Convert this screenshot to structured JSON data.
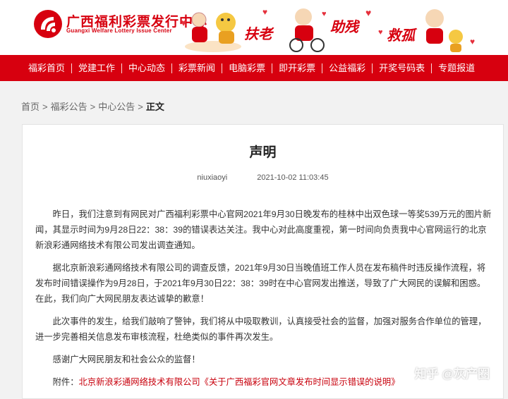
{
  "header": {
    "brand_cn": "广西福利彩票发行中心",
    "brand_en": "Guangxi Welfare Lottery Issue Center",
    "slogans": [
      "扶老",
      "助残",
      "救孤"
    ]
  },
  "nav": {
    "items": [
      "福彩首页",
      "党建工作",
      "中心动态",
      "彩票新闻",
      "电脑彩票",
      "即开彩票",
      "公益福彩",
      "开奖号码表",
      "专题报道"
    ]
  },
  "breadcrumb": {
    "home": "首页",
    "level1": "福彩公告",
    "level2": "中心公告",
    "current": "正文",
    "separator": ">"
  },
  "article": {
    "title": "声明",
    "author": "niuxiaoyi",
    "datetime": "2021-10-02 11:03:45",
    "paragraphs": [
      "昨日，我们注意到有网民对广西福利彩票中心官网2021年9月30日晚发布的桂林中出双色球一等奖539万元的图片新闻，其显示时间为9月28日22：38：39的错误表达关注。我中心对此高度重视，第一时间向负责我中心官网运行的北京新浪彩通网络技术有限公司发出调查通知。",
      "据北京新浪彩通网络技术有限公司的调查反馈，2021年9月30日当晚值班工作人员在发布稿件时违反操作流程，将发布时间错误操作为9月28日，于2021年9月30日22：38：39时在中心官网发出推送，导致了广大网民的误解和困惑。在此，我们向广大网民朋友表达诚挚的歉意！",
      "此次事件的发生，给我们敲响了警钟，我们将从中吸取教训，认真接受社会的监督，加强对服务合作单位的管理，进一步完善相关信息发布审核流程，杜绝类似的事件再次发生。",
      "感谢广大网民朋友和社会公众的监督！"
    ],
    "attachment_label": "附件：",
    "attachment_link": "北京新浪彩通网络技术有限公司《关于广西福彩官网文章发布时间显示错误的说明》"
  },
  "watermark": "知乎 @灰产圈",
  "colors": {
    "brand_red": "#d7000f",
    "link_red": "#c8000c"
  }
}
